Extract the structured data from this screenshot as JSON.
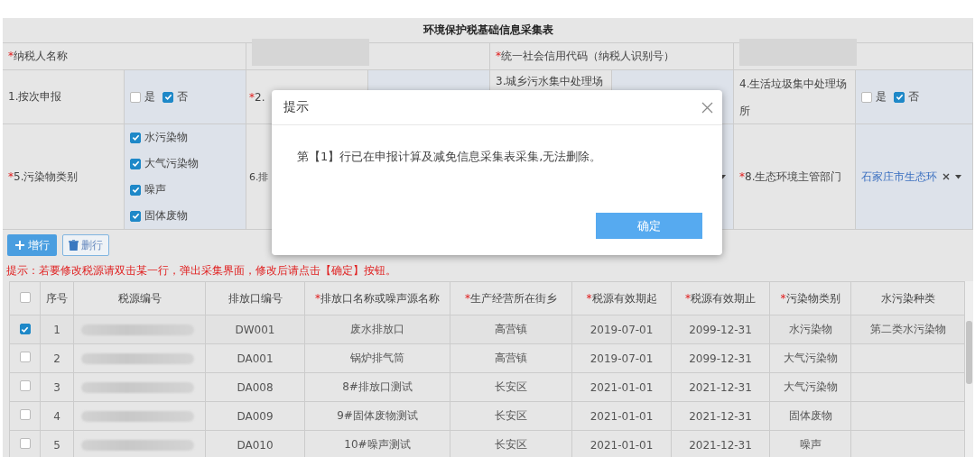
{
  "title": "环境保护税基础信息采集表",
  "form": {
    "taxpayer_name": {
      "label": "纳税人名称",
      "required_mark": "*"
    },
    "credit_code": {
      "label": "统一社会信用代码（纳税人识别号）",
      "required_mark": "*"
    },
    "per_filing": {
      "label": "1.按次申报",
      "options": [
        {
          "label": "是",
          "checked": false
        },
        {
          "label": "否",
          "checked": true
        }
      ]
    },
    "field_2": {
      "label": "2.",
      "required_mark": "*"
    },
    "field_3": {
      "label": "3.城乡污水集中处理场"
    },
    "field_4": {
      "label": "4.生活垃圾集中处理场所",
      "options": [
        {
          "label": "是",
          "checked": false
        },
        {
          "label": "否",
          "checked": true
        }
      ]
    },
    "pollutant_types": {
      "label": "5.污染物类别",
      "required_mark": "*",
      "options": [
        {
          "label": "水污染物",
          "checked": true
        },
        {
          "label": "大气污染物",
          "checked": true
        },
        {
          "label": "噪声",
          "checked": true
        },
        {
          "label": "固体废物",
          "checked": true
        }
      ]
    },
    "field_6": {
      "label": "6.排"
    },
    "authority": {
      "label": "8.生态环境主管部门",
      "required_mark": "*",
      "value": "石家庄市生态环"
    }
  },
  "buttons": [
    {
      "kind": "add",
      "label": "增行"
    },
    {
      "kind": "delete",
      "label": "删行"
    }
  ],
  "hint": "提示：若要修改税源请双击某一行，弹出采集界面，修改后请点击【确定】按钮。",
  "table": {
    "select_all": {
      "checked": false
    },
    "columns": [
      {
        "label": "序号"
      },
      {
        "label": "税源编号"
      },
      {
        "label": "排放口编号"
      },
      {
        "label": "排放口名称或噪声源名称",
        "required_mark": "*"
      },
      {
        "label": "生产经营所在街乡",
        "required_mark": "*"
      },
      {
        "label": "税源有效期起",
        "required_mark": "*"
      },
      {
        "label": "税源有效期止",
        "required_mark": "*"
      },
      {
        "label": "污染物类别",
        "required_mark": "*"
      },
      {
        "label": "水污染种类"
      }
    ],
    "rows": [
      {
        "selected": true,
        "cells": [
          "1",
          null,
          "DW001",
          "废水排放口",
          "高营镇",
          "2019-07-01",
          "2099-12-31",
          "水污染物",
          "第二类水污染物"
        ]
      },
      {
        "selected": false,
        "cells": [
          "2",
          null,
          "DA001",
          "锅炉排气筒",
          "高营镇",
          "2019-07-01",
          "2099-12-31",
          "大气污染物",
          null
        ]
      },
      {
        "selected": false,
        "cells": [
          "3",
          null,
          "DA008",
          "8#排放口测试",
          "长安区",
          "2021-01-01",
          "2021-12-31",
          "大气污染物",
          null
        ]
      },
      {
        "selected": false,
        "cells": [
          "4",
          null,
          "DA009",
          "9#固体废物测试",
          "长安区",
          "2021-01-01",
          "2021-12-31",
          "固体废物",
          null
        ]
      },
      {
        "selected": false,
        "cells": [
          "5",
          null,
          "DA010",
          "10#噪声测试",
          "长安区",
          "2021-01-01",
          "2021-12-31",
          "噪声",
          null
        ]
      }
    ]
  },
  "dialog": {
    "title": "提示",
    "message": "第【1】行已在申报计算及减免信息采集表采集,无法删除。",
    "button": "确定"
  }
}
